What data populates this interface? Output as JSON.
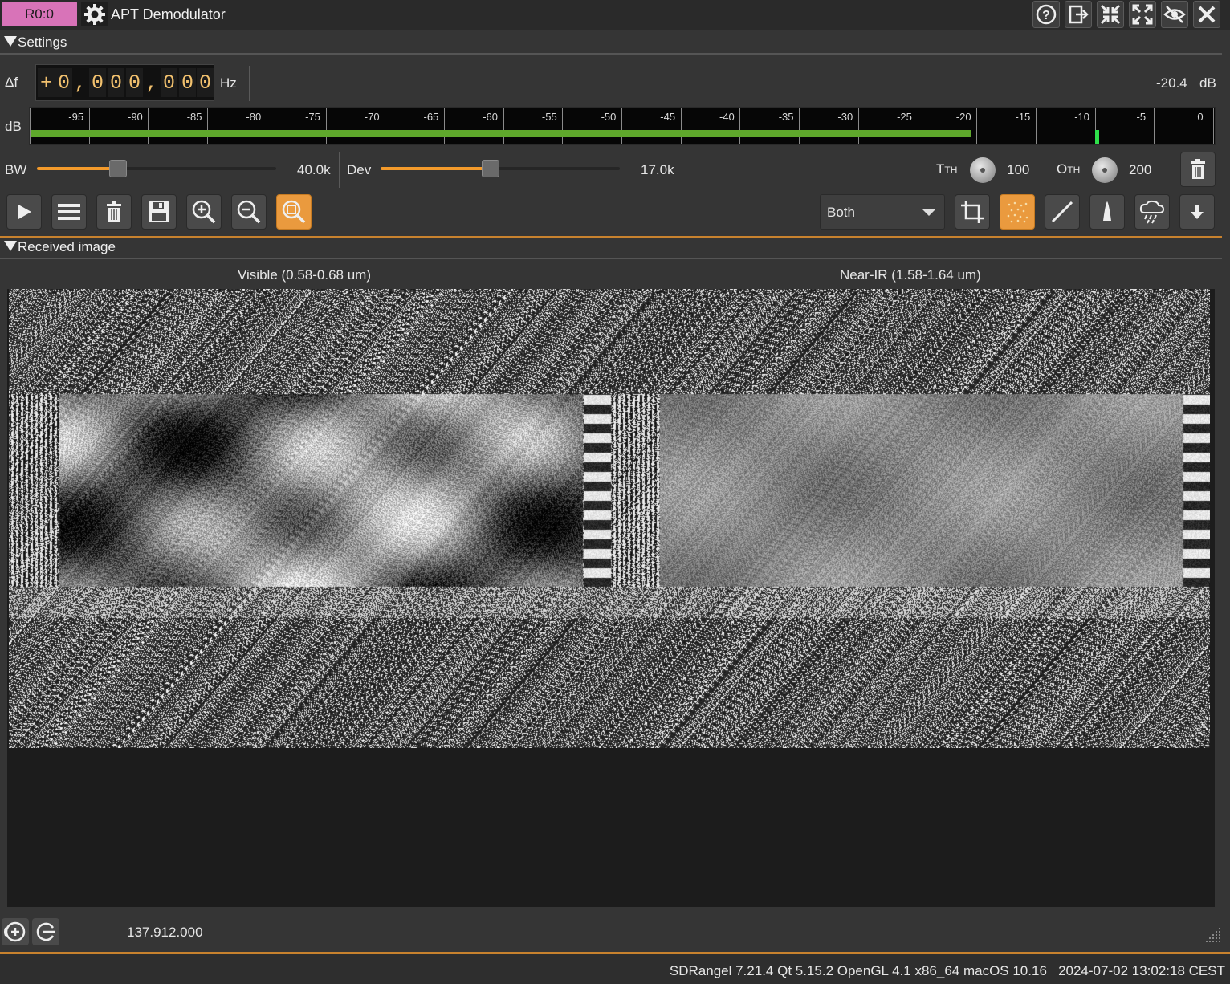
{
  "title_bar": {
    "channel_badge": "R0:0",
    "title": "APT Demodulator",
    "badge_color": "#d873b8",
    "buttons": [
      "help-icon",
      "move-to-workspace-icon",
      "shrink-icon",
      "maximize-icon",
      "hide-icon",
      "close-icon"
    ]
  },
  "settings": {
    "section_label": "Settings",
    "delta_f_label": "Δf",
    "freq_digits": [
      "+",
      "0",
      ",",
      "0",
      "0",
      "0",
      ",",
      "0",
      "0",
      "0"
    ],
    "freq_unit": "Hz",
    "channel_power": "-20.4",
    "channel_power_unit": "dB",
    "meter_label": "dB",
    "meter_ticks": [
      "-95",
      "-90",
      "-85",
      "-80",
      "-75",
      "-70",
      "-65",
      "-60",
      "-55",
      "-50",
      "-45",
      "-40",
      "-35",
      "-30",
      "-25",
      "-20",
      "-15",
      "-10",
      "-5",
      "0"
    ],
    "meter_level_db": -20.4,
    "meter_peak_db": -10,
    "meter_color": "#5fa82c",
    "bw_label": "BW",
    "bw_value": "40.0k",
    "bw_fraction": 0.34,
    "dev_label": "Dev",
    "dev_value": "17.0k",
    "dev_fraction": 0.46,
    "tth_label": "T",
    "tth_sub": "TH",
    "tth_value": "100",
    "oth_label": "O",
    "oth_sub": "TH",
    "oth_value": "200",
    "channels_combo": "Both",
    "accent_color": "#ea9a3e"
  },
  "received_image": {
    "section_label": "Received image",
    "left_channel": "Visible (0.58-0.68 um)",
    "right_channel": "Near-IR (1.58-1.64 um)"
  },
  "bottom_bar": {
    "frequency": "137.912.000"
  },
  "status_bar": {
    "text": "SDRangel 7.21.4 Qt 5.15.2 OpenGL 4.1 x86_64 macOS 10.16   2024-07-02 13:02:18 CEST"
  }
}
